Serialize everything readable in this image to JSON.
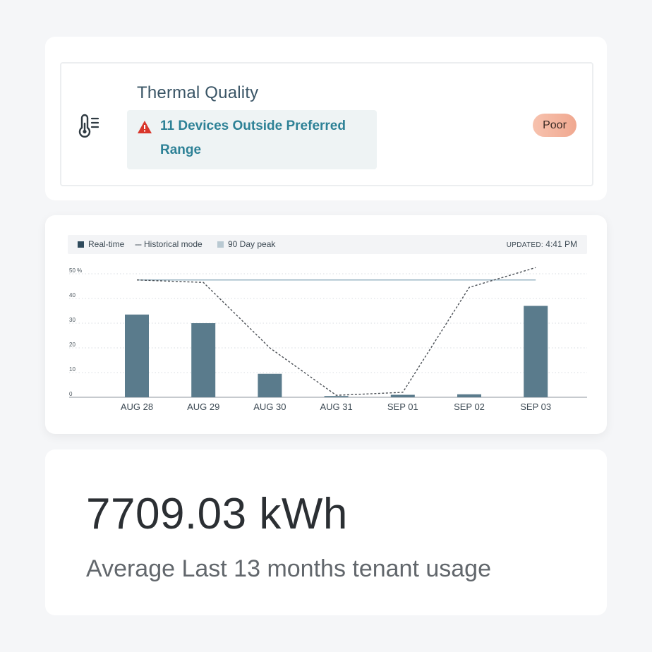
{
  "thermal": {
    "title": "Thermal Quality",
    "alert_text": "11 Devices Outside Preferred Range",
    "status": "Poor",
    "icons": {
      "main": "thermometer-icon",
      "alert": "warning-triangle-icon"
    },
    "colors": {
      "alert_text": "#2d8196",
      "warning": "#d9362b",
      "badge": "#f3b39f"
    }
  },
  "legend": {
    "realtime": "Real-time",
    "historical": "Historical mode",
    "peak": "90 Day peak",
    "updated_label": "UPDATED:",
    "updated_time": "4:41 PM"
  },
  "chart_data": {
    "type": "bar",
    "categories": [
      "AUG 28",
      "AUG 29",
      "AUG 30",
      "AUG 31",
      "SEP 01",
      "SEP 02",
      "SEP 03"
    ],
    "series": [
      {
        "name": "Real-time",
        "type": "bar",
        "values": [
          33.5,
          30,
          9.5,
          0.5,
          1,
          1.2,
          37
        ]
      },
      {
        "name": "Historical mode",
        "type": "line",
        "style": "dashed",
        "values": [
          47.5,
          46.5,
          20,
          0.8,
          2,
          44.5,
          52.5
        ]
      },
      {
        "name": "90 Day peak",
        "type": "line",
        "values": [
          47.5,
          47.5,
          47.5,
          47.5,
          47.5,
          47.5,
          47.5
        ]
      }
    ],
    "yticks": [
      "0",
      "10",
      "20",
      "30",
      "40",
      "50 %"
    ],
    "ylim": [
      0,
      55
    ],
    "grid": true,
    "legend": "top-left",
    "colors": {
      "bar": "#5a7b8c",
      "historical": "#4a4f55",
      "peak": "#9ab4c3"
    }
  },
  "usage": {
    "value": "7709.03 kWh",
    "label": "Average Last 13 months tenant usage"
  }
}
